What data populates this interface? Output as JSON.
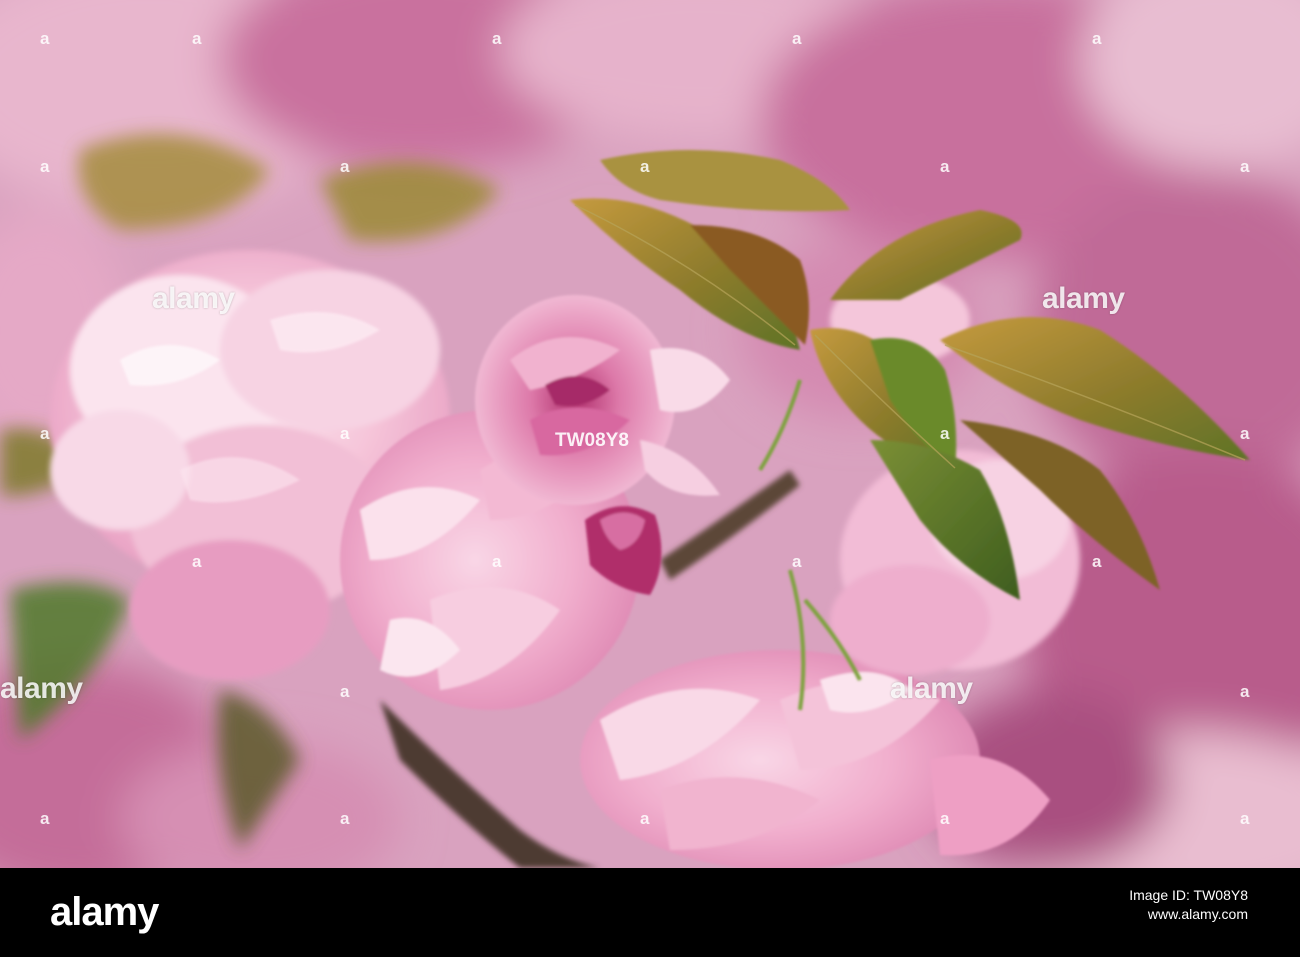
{
  "watermark": {
    "brand": "alamy",
    "image_id": "TW08Y8",
    "corner_mark": "a"
  },
  "footer": {
    "logo": "alamy",
    "image_id_label": "Image ID: TW08Y8",
    "site": "www.alamy.com"
  },
  "colors": {
    "blossom_light": "#f6c9dd",
    "blossom_mid": "#ec9bc3",
    "blossom_deep": "#c94a86",
    "leaf_bronze": "#9a7a2e",
    "leaf_green": "#5f7a2a",
    "branch": "#5b4638",
    "footer_bg": "#000000"
  }
}
